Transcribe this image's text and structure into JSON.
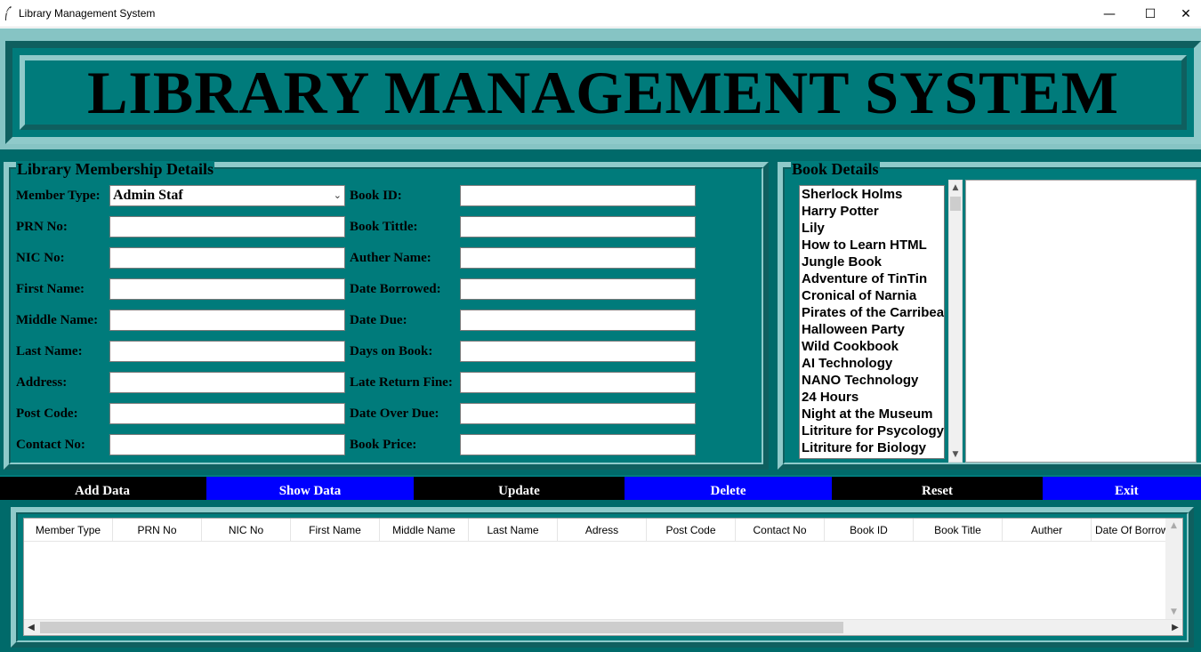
{
  "window": {
    "title": "Library Management System",
    "minimize": "—",
    "maximize": "☐",
    "close": "✕"
  },
  "banner": {
    "heading": "LIBRARY MANAGEMENT SYSTEM"
  },
  "membership": {
    "legend": "Library Membership Details",
    "member_type_label": "Member Type:",
    "member_type_value": "Admin Staf",
    "left_labels": [
      "PRN No:",
      "NIC No:",
      "First Name:",
      "Middle Name:",
      "Last Name:",
      "Address:",
      "Post Code:",
      "Contact No:"
    ],
    "right_labels": [
      "Book ID:",
      "Book Tittle:",
      "Auther Name:",
      "Date Borrowed:",
      "Date Due:",
      "Days on Book:",
      "Late Return Fine:",
      "Date Over Due:",
      "Book Price:"
    ]
  },
  "book_details": {
    "legend": "Book Details",
    "books": [
      "Sherlock Holms",
      "Harry Potter",
      "Lily",
      "How to Learn HTML",
      "Jungle Book",
      "Adventure of TinTin",
      "Cronical of Narnia",
      "Pirates of the Carribean",
      "Halloween Party",
      "Wild Cookbook",
      "AI Technology",
      "NANO Technology",
      "24 Hours",
      "Night at the Museum",
      "Litriture for Psycology",
      "Litriture for Biology"
    ]
  },
  "actions": {
    "add": "Add Data",
    "show": "Show Data",
    "update": "Update",
    "delete": "Delete",
    "reset": "Reset",
    "exit": "Exit"
  },
  "colors": {
    "teal": "#007b7b",
    "dark_band": "#000000",
    "blue_button": "#0000ff"
  },
  "table": {
    "columns": [
      "Member Type",
      "PRN No",
      "NIC No",
      "First Name",
      "Middle Name",
      "Last Name",
      "Adress",
      "Post Code",
      "Contact No",
      "Book ID",
      "Book Title",
      "Auther",
      "Date Of Borrowed"
    ],
    "rows": []
  }
}
